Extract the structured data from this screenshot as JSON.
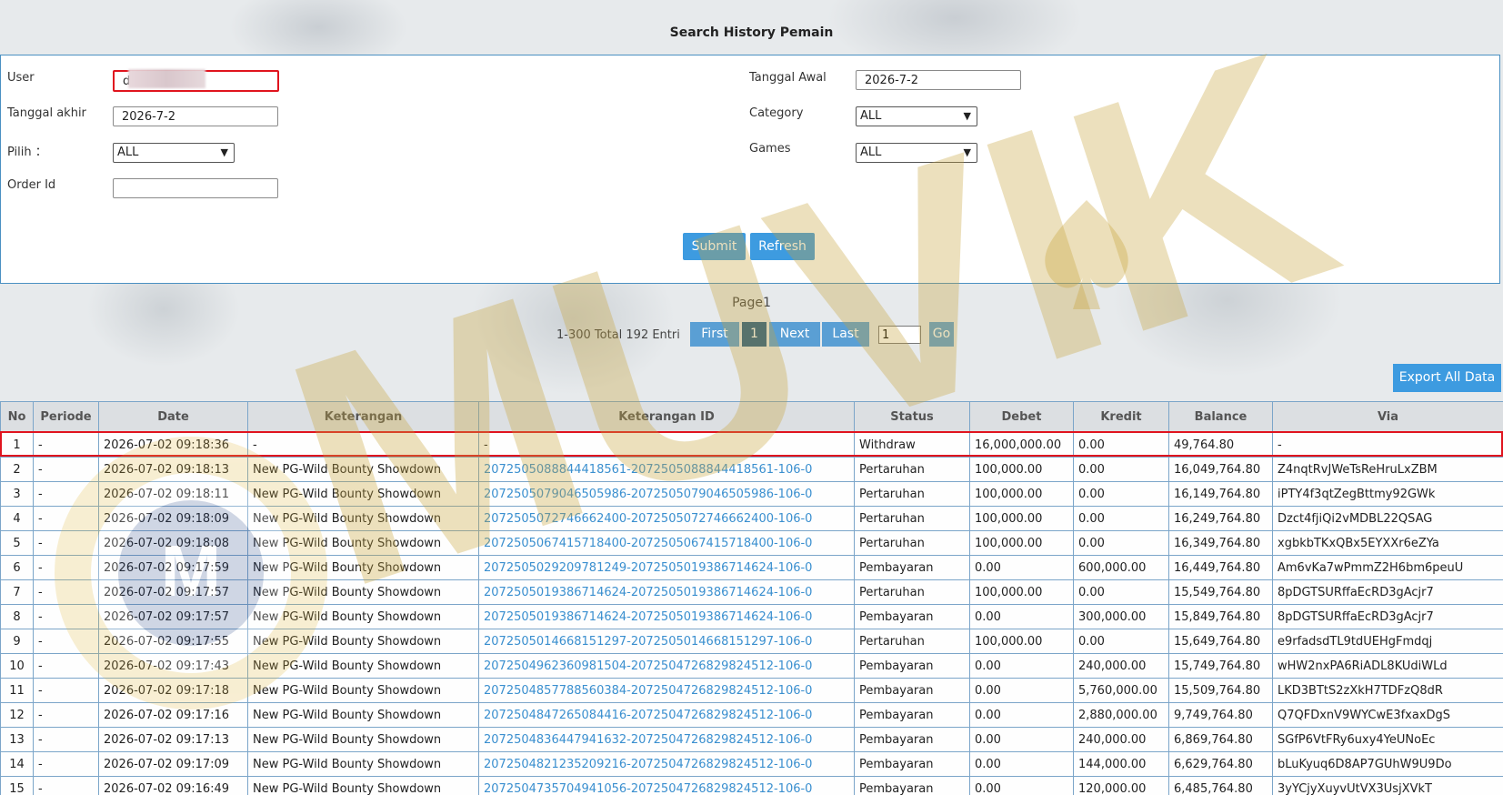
{
  "header": {
    "title": "Search History Pemain"
  },
  "form": {
    "user_label": "User",
    "user_value": "d",
    "tanggal_awal_label": "Tanggal Awal",
    "tanggal_awal_value": "2026-7-2",
    "tanggal_akhir_label": "Tanggal akhir",
    "tanggal_akhir_value": "2026-7-2",
    "category_label": "Category",
    "category_value": "ALL",
    "pilih_label": "Pilih ：",
    "pilih_value": "ALL",
    "games_label": "Games",
    "games_value": "ALL",
    "order_id_label": "Order Id",
    "order_id_value": "",
    "submit_label": "Submit",
    "refresh_label": "Refresh"
  },
  "pager": {
    "page_label": "Page1",
    "summary": "1-300 Total 192 Entri",
    "first_label": "First",
    "current_page": "1",
    "next_label": "Next",
    "last_label": "Last",
    "goto_value": "1",
    "go_label": "Go"
  },
  "export_label": "Export All Data",
  "table": {
    "columns": [
      "No",
      "Periode",
      "Date",
      "Keterangan",
      "Keterangan ID",
      "Status",
      "Debet",
      "Kredit",
      "Balance",
      "Via"
    ],
    "rows": [
      [
        "1",
        "-",
        "2026-07-02 09:18:36",
        "-",
        "-",
        "Withdraw",
        "16,000,000.00",
        "0.00",
        "49,764.80",
        "-"
      ],
      [
        "2",
        "-",
        "2026-07-02 09:18:13",
        "New PG-Wild Bounty Showdown",
        "2072505088844418561-2072505088844418561-106-0",
        "Pertaruhan",
        "100,000.00",
        "0.00",
        "16,049,764.80",
        "Z4nqtRvJWeTsReHruLxZBM"
      ],
      [
        "3",
        "-",
        "2026-07-02 09:18:11",
        "New PG-Wild Bounty Showdown",
        "2072505079046505986-2072505079046505986-106-0",
        "Pertaruhan",
        "100,000.00",
        "0.00",
        "16,149,764.80",
        "iPTY4f3qtZegBttmy92GWk"
      ],
      [
        "4",
        "-",
        "2026-07-02 09:18:09",
        "New PG-Wild Bounty Showdown",
        "2072505072746662400-2072505072746662400-106-0",
        "Pertaruhan",
        "100,000.00",
        "0.00",
        "16,249,764.80",
        "Dzct4fjiQi2vMDBL22QSAG"
      ],
      [
        "5",
        "-",
        "2026-07-02 09:18:08",
        "New PG-Wild Bounty Showdown",
        "2072505067415718400-2072505067415718400-106-0",
        "Pertaruhan",
        "100,000.00",
        "0.00",
        "16,349,764.80",
        "xgbkbTKxQBx5EYXXr6eZYa"
      ],
      [
        "6",
        "-",
        "2026-07-02 09:17:59",
        "New PG-Wild Bounty Showdown",
        "2072505029209781249-2072505019386714624-106-0",
        "Pembayaran",
        "0.00",
        "600,000.00",
        "16,449,764.80",
        "Am6vKa7wPmmZ2H6bm6peuU"
      ],
      [
        "7",
        "-",
        "2026-07-02 09:17:57",
        "New PG-Wild Bounty Showdown",
        "2072505019386714624-2072505019386714624-106-0",
        "Pertaruhan",
        "100,000.00",
        "0.00",
        "15,549,764.80",
        "8pDGTSURffaEcRD3gAcjr7"
      ],
      [
        "8",
        "-",
        "2026-07-02 09:17:57",
        "New PG-Wild Bounty Showdown",
        "2072505019386714624-2072505019386714624-106-0",
        "Pembayaran",
        "0.00",
        "300,000.00",
        "15,849,764.80",
        "8pDGTSURffaEcRD3gAcjr7"
      ],
      [
        "9",
        "-",
        "2026-07-02 09:17:55",
        "New PG-Wild Bounty Showdown",
        "2072505014668151297-2072505014668151297-106-0",
        "Pertaruhan",
        "100,000.00",
        "0.00",
        "15,649,764.80",
        "e9rfadsdTL9tdUEHgFmdqj"
      ],
      [
        "10",
        "-",
        "2026-07-02 09:17:43",
        "New PG-Wild Bounty Showdown",
        "2072504962360981504-2072504726829824512-106-0",
        "Pembayaran",
        "0.00",
        "240,000.00",
        "15,749,764.80",
        "wHW2nxPA6RiADL8KUdiWLd"
      ],
      [
        "11",
        "-",
        "2026-07-02 09:17:18",
        "New PG-Wild Bounty Showdown",
        "2072504857788560384-2072504726829824512-106-0",
        "Pembayaran",
        "0.00",
        "5,760,000.00",
        "15,509,764.80",
        "LKD3BTtS2zXkH7TDFzQ8dR"
      ],
      [
        "12",
        "-",
        "2026-07-02 09:17:16",
        "New PG-Wild Bounty Showdown",
        "2072504847265084416-2072504726829824512-106-0",
        "Pembayaran",
        "0.00",
        "2,880,000.00",
        "9,749,764.80",
        "Q7QFDxnV9WYCwE3fxaxDgS"
      ],
      [
        "13",
        "-",
        "2026-07-02 09:17:13",
        "New PG-Wild Bounty Showdown",
        "2072504836447941632-2072504726829824512-106-0",
        "Pembayaran",
        "0.00",
        "240,000.00",
        "6,869,764.80",
        "SGfP6VtFRy6uxy4YeUNoEc"
      ],
      [
        "14",
        "-",
        "2026-07-02 09:17:09",
        "New PG-Wild Bounty Showdown",
        "2072504821235209216-2072504726829824512-106-0",
        "Pembayaran",
        "0.00",
        "144,000.00",
        "6,629,764.80",
        "bLuKyuq6D8AP7GUhW9U9Do"
      ],
      [
        "15",
        "-",
        "2026-07-02 09:16:49",
        "New PG-Wild Bounty Showdown",
        "2072504735704941056-2072504726829824512-106-0",
        "Pembayaran",
        "0.00",
        "120,000.00",
        "6,485,764.80",
        "3yYCjyXuyvUtVX3UsjXVkT"
      ]
    ]
  },
  "watermark": {
    "text": "MUVIK",
    "icon": "spade-icon"
  },
  "colors": {
    "accent": "#3d9be0",
    "highlight": "#e0141e",
    "link": "#3a8fcf"
  }
}
